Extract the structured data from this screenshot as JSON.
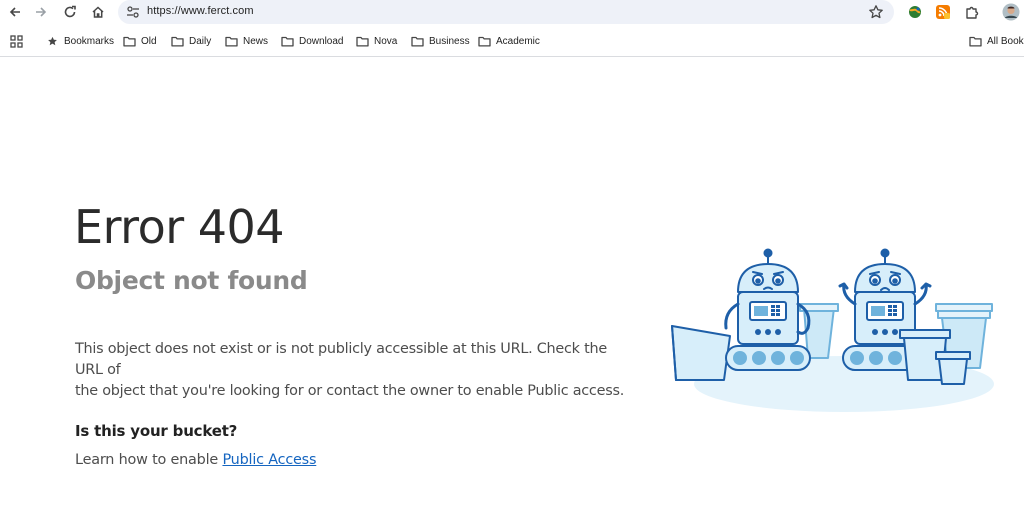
{
  "browser": {
    "url": "https://www.ferct.com",
    "icons": [
      "back-icon",
      "forward-icon",
      "reload-icon",
      "home-icon",
      "site-settings-icon",
      "bookmark-star-icon",
      "extension-globe-icon",
      "extension-rss-icon",
      "extensions-puzzle-icon",
      "profile-avatar"
    ]
  },
  "bookmarks_bar": {
    "apps_icon": "apps-grid-icon",
    "items": [
      {
        "label": "Bookmarks",
        "icon": "star-icon"
      },
      {
        "label": "Old",
        "icon": "folder-icon"
      },
      {
        "label": "Daily",
        "icon": "folder-icon"
      },
      {
        "label": "News",
        "icon": "folder-icon"
      },
      {
        "label": "Download",
        "icon": "folder-icon"
      },
      {
        "label": "Nova",
        "icon": "folder-icon"
      },
      {
        "label": "Business",
        "icon": "folder-icon"
      },
      {
        "label": "Academic",
        "icon": "folder-icon"
      }
    ],
    "all_bookmarks_label": "All Bookm"
  },
  "page": {
    "title": "Error 404",
    "subtitle": "Object not found",
    "body_line1": "This object does not exist or is not publicly accessible at this URL. Check the URL of",
    "body_line2": "the object that you're looking for or contact the owner to enable Public access.",
    "question": "Is this your bucket?",
    "learn_prefix": "Learn how to enable ",
    "learn_link": "Public Access"
  },
  "colors": {
    "accent_blue": "#1565c0",
    "robot_fill": "#d7eefa",
    "robot_stroke": "#1e5fa8"
  }
}
